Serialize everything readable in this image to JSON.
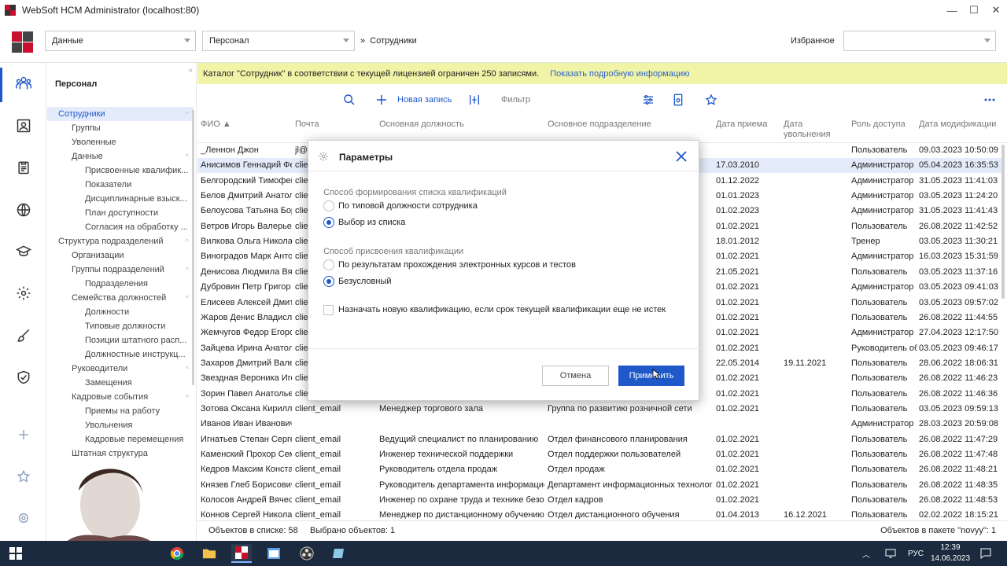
{
  "window": {
    "title": "WebSoft HCM Administrator (localhost:80)",
    "controls": [
      "—",
      "☐",
      "✕"
    ]
  },
  "topbar": {
    "combo1": "Данные",
    "combo2": "Персонал",
    "crumb_sep": "»",
    "crumb": "Сотрудники",
    "favorites_label": "Избранное",
    "favorites_value": ""
  },
  "rail": {
    "icons": [
      "people-icon",
      "id-card-icon",
      "clipboard-icon",
      "globe-icon",
      "graduation-cap-icon",
      "gear-icon",
      "brush-icon",
      "shield-check-icon",
      "plus-icon",
      "star-icon",
      "settings-icon"
    ]
  },
  "tree": {
    "title": "Персонал",
    "nodes": [
      {
        "label": "Сотрудники",
        "level": 0,
        "selected": true,
        "exp": "^"
      },
      {
        "label": "Группы",
        "level": 1
      },
      {
        "label": "Уволенные",
        "level": 1
      },
      {
        "label": "Данные",
        "level": 1,
        "exp": "^"
      },
      {
        "label": "Присвоенные квалифик...",
        "level": 2
      },
      {
        "label": "Показатели",
        "level": 2
      },
      {
        "label": "Дисциплинарные взыск...",
        "level": 2
      },
      {
        "label": "План доступности",
        "level": 2
      },
      {
        "label": "Согласия на обработку ...",
        "level": 2
      },
      {
        "label": "Структура подразделений",
        "level": 0,
        "exp": "^"
      },
      {
        "label": "Организации",
        "level": 1
      },
      {
        "label": "Группы подразделений",
        "level": 1,
        "exp": "^"
      },
      {
        "label": "Подразделения",
        "level": 2
      },
      {
        "label": "Семейства должностей",
        "level": 1,
        "exp": "^"
      },
      {
        "label": "Должности",
        "level": 2
      },
      {
        "label": "Типовые должности",
        "level": 2
      },
      {
        "label": "Позиции штатного расп...",
        "level": 2
      },
      {
        "label": "Должностные инструкц...",
        "level": 2
      },
      {
        "label": "Руководители",
        "level": 1,
        "exp": "^"
      },
      {
        "label": "Замещения",
        "level": 2
      },
      {
        "label": "Кадровые события",
        "level": 1,
        "exp": "^"
      },
      {
        "label": "Приемы на работу",
        "level": 2
      },
      {
        "label": "Увольнения",
        "level": 2
      },
      {
        "label": "Кадровые перемещения",
        "level": 2
      },
      {
        "label": "Штатная структура",
        "level": 1
      }
    ]
  },
  "banner": {
    "text": "Каталог \"Сотрудник\" в соответствии с текущей лицензией ограничен 250 записями.",
    "link": "Показать подробную информацию"
  },
  "toolbar": {
    "new_record": "Новая запись",
    "filter_placeholder": "Фильтр"
  },
  "grid": {
    "columns": [
      "ФИО ▲",
      "Почта",
      "Основная должность",
      "Основное подразделение",
      "Дата приема",
      "Дата увольнения",
      "Роль доступа",
      "Дата модификации"
    ],
    "rows": [
      [
        "_Леннон Джон",
        "jl@",
        "",
        "",
        "",
        "",
        "Пользователь",
        "09.03.2023 10:50:09"
      ],
      [
        "Анисимов Геннадий Фе",
        "clie",
        "",
        "",
        "17.03.2010",
        "",
        "Администратор",
        "05.04.2023 16:35:53"
      ],
      [
        "Белгородский Тимофей",
        "clie",
        "",
        "",
        "01.12.2022",
        "",
        "Администратор",
        "31.05.2023 11:41:03"
      ],
      [
        "Белов Дмитрий Анатол",
        "clie",
        "",
        "",
        "01.01.2023",
        "",
        "Администратор",
        "03.05.2023 11:24:20"
      ],
      [
        "Белоусова Татьяна Бор",
        "clie",
        "",
        "",
        "01.02.2023",
        "",
        "Администратор",
        "31.05.2023 11:41:43"
      ],
      [
        "Ветров Игорь Валерьев",
        "clie",
        "",
        "",
        "01.02.2021",
        "",
        "Пользователь",
        "26.08.2022 11:42:52"
      ],
      [
        "Вилкова Ольга Николае",
        "clie",
        "",
        "",
        "18.01.2012",
        "",
        "Тренер",
        "03.05.2023 11:30:21"
      ],
      [
        "Виноградов Марк Анто",
        "clie",
        "",
        "",
        "01.02.2021",
        "",
        "Администратор",
        "16.03.2023 15:31:59"
      ],
      [
        "Денисова Людмила Вяч",
        "clie",
        "",
        "",
        "21.05.2021",
        "",
        "Пользователь",
        "03.05.2023 11:37:16"
      ],
      [
        "Дубровин Петр Григор",
        "clie",
        "",
        "",
        "01.02.2021",
        "",
        "Администратор",
        "03.05.2023 09:41:03"
      ],
      [
        "Елисеев Алексей Дмитр",
        "clie",
        "",
        "",
        "01.02.2021",
        "",
        "Пользователь",
        "03.05.2023 09:57:02"
      ],
      [
        "Жаров Денис Владислав",
        "clie",
        "",
        "",
        "01.02.2021",
        "",
        "Пользователь",
        "26.08.2022 11:44:55"
      ],
      [
        "Жемчугов Федор Егоро",
        "clie",
        "",
        "",
        "01.02.2021",
        "",
        "Администратор",
        "27.04.2023 12:17:50"
      ],
      [
        "Зайцева Ирина Анатол",
        "clie",
        "",
        "",
        "01.02.2021",
        "",
        "Руководитель об",
        "03.05.2023 09:46:17"
      ],
      [
        "Захаров Дмитрий Валер",
        "clie",
        "",
        "",
        "22.05.2014",
        "19.11.2021",
        "Пользователь",
        "28.06.2022 18:06:31"
      ],
      [
        "Звездная Вероника Иго",
        "clie",
        "",
        "",
        "01.02.2021",
        "",
        "Пользователь",
        "26.08.2022 11:46:23"
      ],
      [
        "Зорин Павел Анатольев",
        "clie",
        "",
        "",
        "01.02.2021",
        "",
        "Пользователь",
        "26.08.2022 11:46:36"
      ],
      [
        "Зотова Оксана Кирилло",
        "client_email",
        "Менеджер торгового зала",
        "Группа по развитию розничной сети",
        "01.02.2021",
        "",
        "Пользователь",
        "03.05.2023 09:59:13"
      ],
      [
        "Иванов Иван Иванович",
        "",
        "",
        "",
        "",
        "",
        "Администратор",
        "28.03.2023 20:59:08"
      ],
      [
        "Игнатьев Степан Сергее",
        "client_email",
        "Ведущий специалист по планированию",
        "Отдел финансового планирования",
        "01.02.2021",
        "",
        "Пользователь",
        "26.08.2022 11:47:29"
      ],
      [
        "Каменский Прохор Сем",
        "client_email",
        "Инженер технической поддержки",
        "Отдел поддержки пользователей",
        "01.02.2021",
        "",
        "Пользователь",
        "26.08.2022 11:47:48"
      ],
      [
        "Кедров Максим Конста",
        "client_email",
        "Руководитель отдела продаж",
        "Отдел продаж",
        "01.02.2021",
        "",
        "Пользователь",
        "26.08.2022 11:48:21"
      ],
      [
        "Князев Глеб Борисович",
        "client_email",
        "Руководитель департамента информацион",
        "Департамент информационных технологий",
        "01.02.2021",
        "",
        "Пользователь",
        "26.08.2022 11:48:35"
      ],
      [
        "Колосов Андрей Вячесл",
        "client_email",
        "Инженер по охране труда и технике безопа",
        "Отдел кадров",
        "01.02.2021",
        "",
        "Пользователь",
        "26.08.2022 11:48:53"
      ],
      [
        "Коннов Сергей Николае",
        "client_email",
        "Менеджер по дистанционному обучению",
        "Отдел дистанционного обучения",
        "01.04.2013",
        "16.12.2021",
        "Пользователь",
        "02.02.2022 18:15:21"
      ]
    ]
  },
  "status": {
    "count": "Объектов в списке: 58",
    "selected": "Выбрано объектов: 1",
    "package": "Объектов в пакете \"novyy\": 1"
  },
  "dialog": {
    "title": "Параметры",
    "group1_label": "Способ формирования списка квалификаций",
    "g1_opt1": "По типовой должности сотрудника",
    "g1_opt2": "Выбор из списка",
    "group2_label": "Способ присвоения квалификации",
    "g2_opt1": "По результатам прохождения электронных курсов и тестов",
    "g2_opt2": "Безусловный",
    "checkbox": "Назначать новую квалификацию, если срок текущей квалификации еще не истек",
    "cancel": "Отмена",
    "apply": "Применить"
  },
  "taskbar": {
    "lang": "РУС",
    "time": "12:39",
    "date": "14.06.2023"
  },
  "colors": {
    "accent": "#1f59c9",
    "banner": "#f1f3a7",
    "selected_row": "#e4ecfb",
    "taskbar": "#1b2a3e"
  }
}
